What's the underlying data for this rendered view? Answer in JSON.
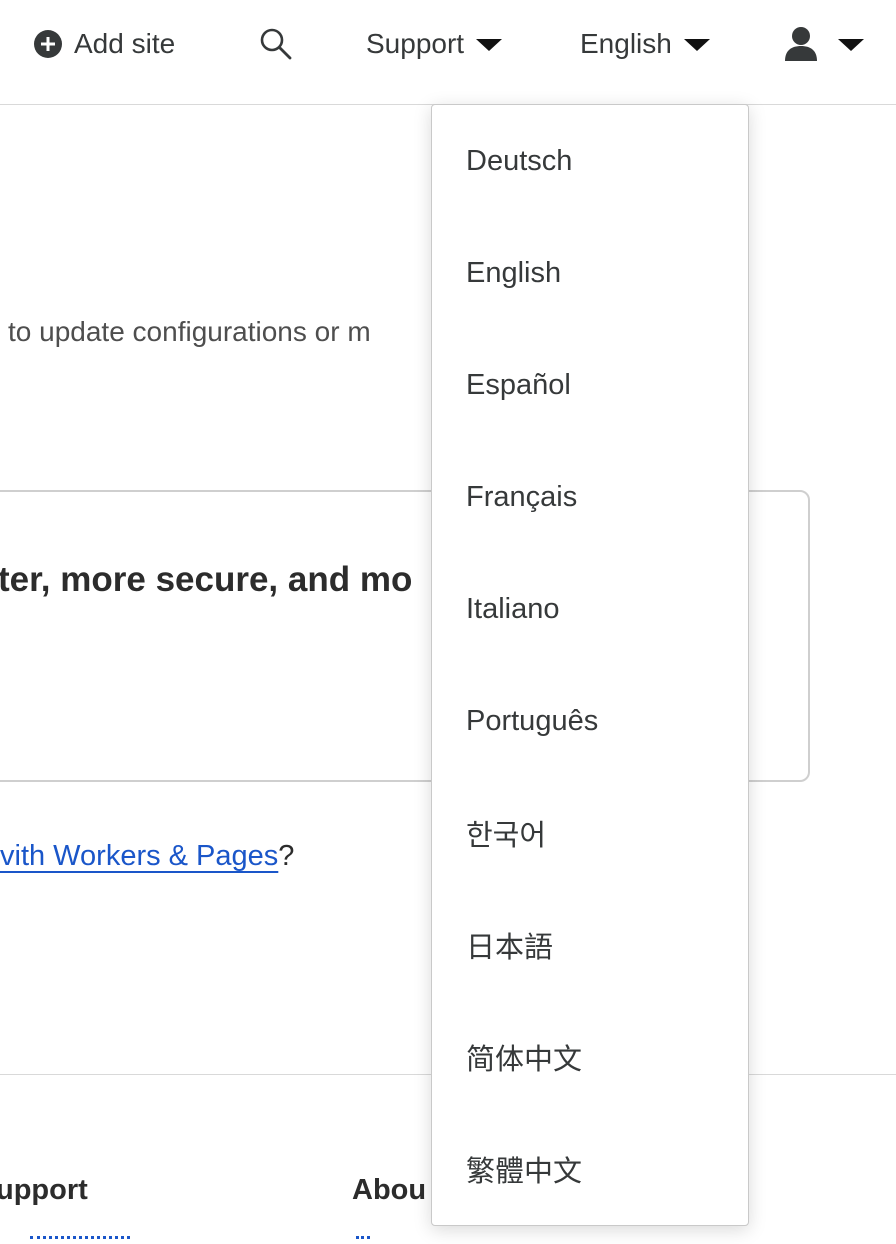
{
  "topbar": {
    "add_site_label": "Add site",
    "support_label": "Support",
    "language_label": "English"
  },
  "main": {
    "description_fragment": "to update configurations or m",
    "card_title_fragment": "ter, more secure, and mo",
    "prompt_link": "vith Workers & Pages",
    "prompt_suffix": "?"
  },
  "footer": {
    "support_heading": "upport",
    "about_heading": "Abou"
  },
  "language_menu": {
    "items": [
      {
        "label": "Deutsch"
      },
      {
        "label": "English"
      },
      {
        "label": "Español"
      },
      {
        "label": "Français"
      },
      {
        "label": "Italiano"
      },
      {
        "label": "Português"
      },
      {
        "label": "한국어"
      },
      {
        "label": "日本語"
      },
      {
        "label": "简体中文"
      },
      {
        "label": "繁體中文"
      }
    ]
  }
}
